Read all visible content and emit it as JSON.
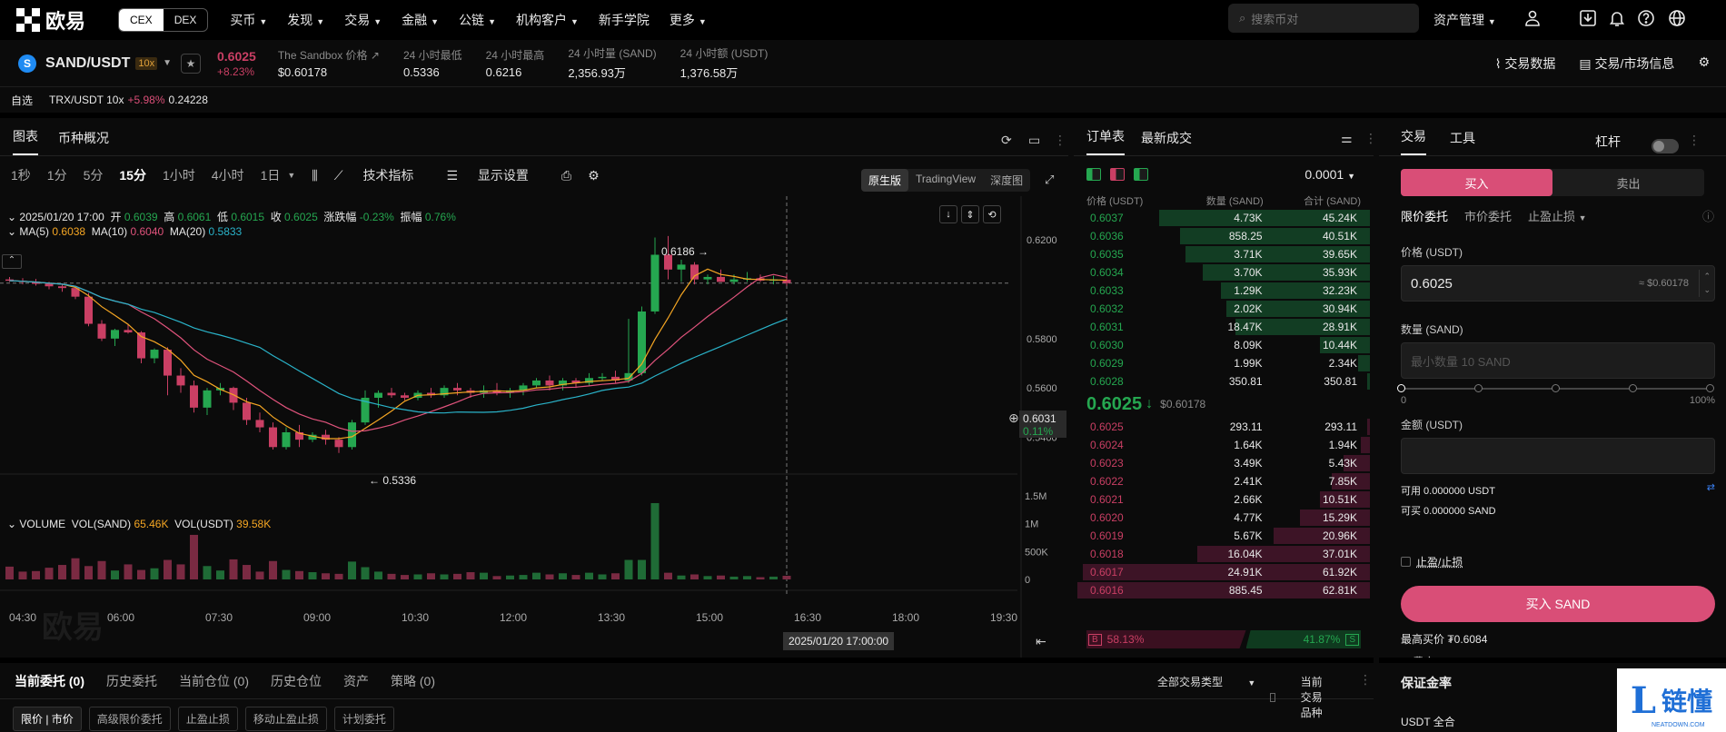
{
  "nav": {
    "logo_text": "欧易",
    "cex": "CEX",
    "dex": "DEX",
    "links": [
      "买币",
      "发现",
      "交易",
      "金融",
      "公链",
      "机构客户",
      "新手学院",
      "更多"
    ],
    "search_placeholder": "搜索币对",
    "asset_mgmt": "资产管理"
  },
  "ticker": {
    "coin_letter": "S",
    "pair": "SAND/USDT",
    "leverage": "10x",
    "last": "0.6025",
    "change": "+8.23%",
    "stats": [
      {
        "label": "The Sandbox 价格 ↗",
        "value": "$0.60178"
      },
      {
        "label": "24 小时最低",
        "value": "0.5336"
      },
      {
        "label": "24 小时最高",
        "value": "0.6216"
      },
      {
        "label": "24 小时量 (SAND)",
        "value": "2,356.93万"
      },
      {
        "label": "24 小时额 (USDT)",
        "value": "1,376.58万"
      }
    ],
    "right_links": [
      "交易数据",
      "交易/市场信息"
    ]
  },
  "watch": {
    "label": "自选",
    "pair": "TRX/USDT 10x",
    "change": "+5.98%",
    "price": "0.24228"
  },
  "chart": {
    "tabs": [
      "图表",
      "币种概况"
    ],
    "timeframes": [
      "1秒",
      "1分",
      "5分",
      "15分",
      "1小时",
      "4小时",
      "1日"
    ],
    "active_tf": "15分",
    "tools": [
      "技术指标",
      "显示设置"
    ],
    "views": [
      "原生版",
      "TradingView",
      "深度图"
    ],
    "ohlc": {
      "date": "2025/01/20 17:00",
      "o_label": "开",
      "o": "0.6039",
      "h_label": "高",
      "h": "0.6061",
      "l_label": "低",
      "l": "0.6015",
      "c_label": "收",
      "c": "0.6025",
      "chg_label": "涨跌幅",
      "chg": "-0.23%",
      "amp_label": "振幅",
      "amp": "0.76%"
    },
    "ma": {
      "ma5_label": "MA(5)",
      "ma5": "0.6038",
      "ma10_label": "MA(10)",
      "ma10": "0.6040",
      "ma20_label": "MA(20)",
      "ma20": "0.5833"
    },
    "vol": {
      "title": "VOLUME",
      "sand_label": "VOL(SAND)",
      "sand": "65.46K",
      "usdt_label": "VOL(USDT)",
      "usdt": "39.58K"
    },
    "price_label": "0.6031",
    "price_pct": "0.11%",
    "high_mark": "0.6186",
    "low_mark": "0.5336",
    "crosshair_time": "2025/01/20 17:00:00",
    "watermark": "欧易"
  },
  "chart_data": {
    "type": "candlestick",
    "title": "",
    "y_ticks": [
      "0.6200",
      "0.5800",
      "0.5600",
      "0.5400"
    ],
    "y_range": [
      0.528,
      0.6245
    ],
    "vol_ticks": [
      "1.5M",
      "1M",
      "500K",
      "0"
    ],
    "vol_range": [
      0,
      1500000
    ],
    "x_ticks": [
      "04:30",
      "06:00",
      "07:30",
      "09:00",
      "10:30",
      "12:00",
      "13:30",
      "15:00",
      "16:30",
      "18:00",
      "19:30"
    ],
    "candles": [
      [
        0.604,
        0.605,
        0.603,
        0.6035,
        230000
      ],
      [
        0.6035,
        0.6045,
        0.602,
        0.603,
        140000
      ],
      [
        0.603,
        0.6042,
        0.6015,
        0.6022,
        150000
      ],
      [
        0.6022,
        0.603,
        0.6,
        0.6012,
        210000
      ],
      [
        0.6012,
        0.602,
        0.599,
        0.6005,
        260000
      ],
      [
        0.6005,
        0.6015,
        0.596,
        0.597,
        380000
      ],
      [
        0.597,
        0.5985,
        0.585,
        0.586,
        240000
      ],
      [
        0.586,
        0.5875,
        0.579,
        0.58,
        330000
      ],
      [
        0.58,
        0.584,
        0.577,
        0.5835,
        160000
      ],
      [
        0.5835,
        0.586,
        0.582,
        0.5825,
        270000
      ],
      [
        0.5825,
        0.583,
        0.57,
        0.572,
        170000
      ],
      [
        0.572,
        0.576,
        0.57,
        0.5755,
        200000
      ],
      [
        0.5755,
        0.5765,
        0.557,
        0.565,
        350000
      ],
      [
        0.565,
        0.568,
        0.558,
        0.561,
        270000
      ],
      [
        0.561,
        0.563,
        0.55,
        0.552,
        800000
      ],
      [
        0.552,
        0.56,
        0.549,
        0.559,
        240000
      ],
      [
        0.559,
        0.562,
        0.557,
        0.56,
        160000
      ],
      [
        0.56,
        0.5605,
        0.551,
        0.554,
        360000
      ],
      [
        0.554,
        0.556,
        0.545,
        0.547,
        260000
      ],
      [
        0.547,
        0.55,
        0.542,
        0.544,
        140000
      ],
      [
        0.544,
        0.546,
        0.535,
        0.536,
        330000
      ],
      [
        0.536,
        0.544,
        0.535,
        0.542,
        170000
      ],
      [
        0.542,
        0.545,
        0.536,
        0.539,
        150000
      ],
      [
        0.539,
        0.542,
        0.538,
        0.541,
        130000
      ],
      [
        0.541,
        0.543,
        0.537,
        0.539,
        110000
      ],
      [
        0.539,
        0.54,
        0.5336,
        0.536,
        100000
      ],
      [
        0.536,
        0.547,
        0.535,
        0.546,
        320000
      ],
      [
        0.546,
        0.559,
        0.545,
        0.556,
        220000
      ],
      [
        0.556,
        0.559,
        0.552,
        0.558,
        140000
      ],
      [
        0.558,
        0.56,
        0.556,
        0.557,
        100000
      ],
      [
        0.557,
        0.558,
        0.555,
        0.556,
        80000
      ],
      [
        0.556,
        0.559,
        0.555,
        0.558,
        90000
      ],
      [
        0.558,
        0.56,
        0.556,
        0.557,
        110000
      ],
      [
        0.557,
        0.561,
        0.556,
        0.56,
        90000
      ],
      [
        0.56,
        0.562,
        0.557,
        0.559,
        100000
      ],
      [
        0.559,
        0.56,
        0.556,
        0.558,
        130000
      ],
      [
        0.558,
        0.561,
        0.556,
        0.559,
        120000
      ],
      [
        0.559,
        0.562,
        0.557,
        0.558,
        60000
      ],
      [
        0.558,
        0.56,
        0.556,
        0.559,
        70000
      ],
      [
        0.559,
        0.562,
        0.557,
        0.561,
        80000
      ],
      [
        0.561,
        0.564,
        0.56,
        0.563,
        120000
      ],
      [
        0.563,
        0.565,
        0.559,
        0.561,
        90000
      ],
      [
        0.561,
        0.564,
        0.559,
        0.563,
        110000
      ],
      [
        0.563,
        0.564,
        0.56,
        0.562,
        80000
      ],
      [
        0.562,
        0.566,
        0.561,
        0.564,
        120000
      ],
      [
        0.564,
        0.566,
        0.563,
        0.5645,
        90000
      ],
      [
        0.5645,
        0.567,
        0.562,
        0.563,
        110000
      ],
      [
        0.563,
        0.588,
        0.562,
        0.566,
        350000
      ],
      [
        0.566,
        0.593,
        0.565,
        0.591,
        350000
      ],
      [
        0.591,
        0.621,
        0.59,
        0.614,
        1370000
      ],
      [
        0.614,
        0.6216,
        0.604,
        0.608,
        120000
      ],
      [
        0.608,
        0.612,
        0.603,
        0.61,
        70000
      ],
      [
        0.61,
        0.611,
        0.602,
        0.604,
        90000
      ],
      [
        0.604,
        0.606,
        0.602,
        0.605,
        60000
      ],
      [
        0.605,
        0.608,
        0.603,
        0.603,
        70000
      ],
      [
        0.603,
        0.606,
        0.602,
        0.604,
        50000
      ],
      [
        0.604,
        0.607,
        0.603,
        0.6045,
        60000
      ],
      [
        0.6045,
        0.606,
        0.603,
        0.6035,
        40000
      ],
      [
        0.6035,
        0.6055,
        0.602,
        0.604,
        50000
      ],
      [
        0.6039,
        0.6061,
        0.6015,
        0.6025,
        65460
      ]
    ],
    "series": [
      {
        "name": "MA(5)",
        "color": "#f5a623"
      },
      {
        "name": "MA(10)",
        "color": "#e0537c"
      },
      {
        "name": "MA(20)",
        "color": "#2ab3c9"
      }
    ]
  },
  "orderbook": {
    "tabs": [
      "订单表",
      "最新成交"
    ],
    "precision": "0.0001",
    "headers": [
      "价格 (USDT)",
      "数量 (SAND)",
      "合计 (SAND)"
    ],
    "asks": [
      {
        "price": "0.6037",
        "qty": "4.73K",
        "total": "45.24K",
        "depth": 0.72
      },
      {
        "price": "0.6036",
        "qty": "858.25",
        "total": "40.51K",
        "depth": 0.65
      },
      {
        "price": "0.6035",
        "qty": "3.71K",
        "total": "39.65K",
        "depth": 0.63
      },
      {
        "price": "0.6034",
        "qty": "3.70K",
        "total": "35.93K",
        "depth": 0.57
      },
      {
        "price": "0.6033",
        "qty": "1.29K",
        "total": "32.23K",
        "depth": 0.51
      },
      {
        "price": "0.6032",
        "qty": "2.02K",
        "total": "30.94K",
        "depth": 0.49
      },
      {
        "price": "0.6031",
        "qty": "18.47K",
        "total": "28.91K",
        "depth": 0.46
      },
      {
        "price": "0.6030",
        "qty": "8.09K",
        "total": "10.44K",
        "depth": 0.17
      },
      {
        "price": "0.6029",
        "qty": "1.99K",
        "total": "2.34K",
        "depth": 0.04
      },
      {
        "price": "0.6028",
        "qty": "350.81",
        "total": "350.81",
        "depth": 0.01
      }
    ],
    "last": "0.6025",
    "last_usd": "$0.60178",
    "bids": [
      {
        "price": "0.6025",
        "qty": "293.11",
        "total": "293.11",
        "depth": 0.01
      },
      {
        "price": "0.6024",
        "qty": "1.64K",
        "total": "1.94K",
        "depth": 0.03
      },
      {
        "price": "0.6023",
        "qty": "3.49K",
        "total": "5.43K",
        "depth": 0.09
      },
      {
        "price": "0.6022",
        "qty": "2.41K",
        "total": "7.85K",
        "depth": 0.13
      },
      {
        "price": "0.6021",
        "qty": "2.66K",
        "total": "10.51K",
        "depth": 0.17
      },
      {
        "price": "0.6020",
        "qty": "4.77K",
        "total": "15.29K",
        "depth": 0.24
      },
      {
        "price": "0.6019",
        "qty": "5.67K",
        "total": "20.96K",
        "depth": 0.33
      },
      {
        "price": "0.6018",
        "qty": "16.04K",
        "total": "37.01K",
        "depth": 0.59
      },
      {
        "price": "0.6017",
        "qty": "24.91K",
        "total": "61.92K",
        "depth": 0.98
      },
      {
        "price": "0.6016",
        "qty": "885.45",
        "total": "62.81K",
        "depth": 1.0
      }
    ],
    "buy_letter": "B",
    "buy_pct": "58.13%",
    "sell_pct": "41.87%",
    "sell_letter": "S"
  },
  "trade": {
    "tabs": [
      "交易",
      "工具"
    ],
    "leverage_label": "杠杆",
    "buy": "买入",
    "sell": "卖出",
    "order_types": [
      "限价委托",
      "市价委托",
      "止盈止损"
    ],
    "price_label": "价格 (USDT)",
    "price_value": "0.6025",
    "price_usd": "≈ $0.60178",
    "qty_label": "数量 (SAND)",
    "qty_placeholder": "最小数量 10 SAND",
    "slider_min": "0",
    "slider_max": "100%",
    "amount_label": "金额 (USDT)",
    "avail_usdt": "可用 0.000000 USDT",
    "avail_sand": "可买 0.000000 SAND",
    "tpsl": "止盈/止损",
    "buy_button": "买入 SAND",
    "max_buy": "最高买价 ₮0.6084",
    "fee": "费率"
  },
  "bottom": {
    "tabs": [
      "当前委托 (0)",
      "历史委托",
      "当前仓位 (0)",
      "历史仓位",
      "资产",
      "策略 (0)"
    ],
    "filter": "全部交易类型",
    "current_only": "当前交易品种",
    "subtabs": [
      "限价 | 市价",
      "高级限价委托",
      "止盈止损",
      "移动止盈止损",
      "计划委托"
    ]
  },
  "margin": {
    "title": "保证金率",
    "sub": "USDT 全合"
  },
  "badge": {
    "logo_letter": "L",
    "text": "链懂",
    "url": "NEATDOWN.COM"
  },
  "colors": {
    "up": "#25a750",
    "down": "#ca3f64",
    "accent": "#d94e77"
  }
}
